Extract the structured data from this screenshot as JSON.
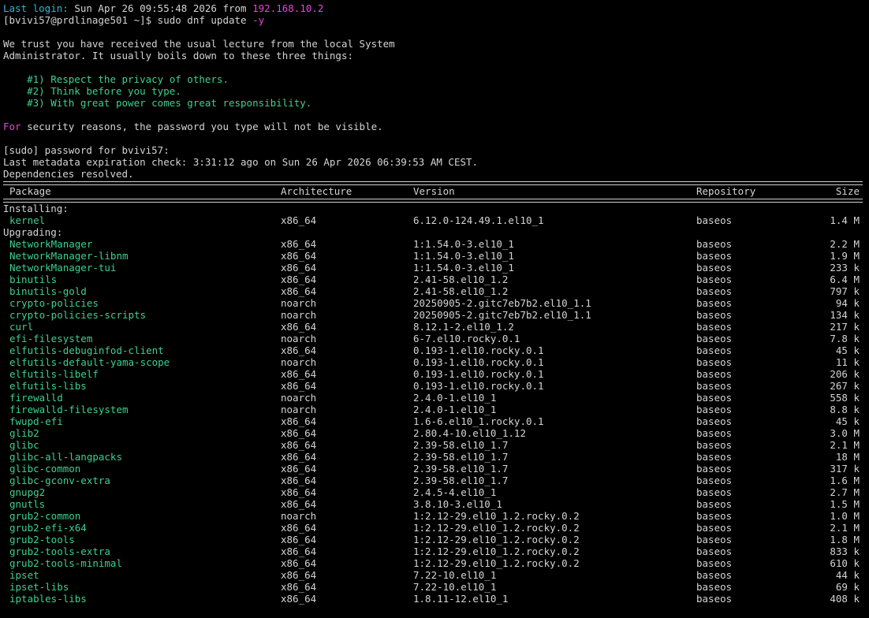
{
  "login": {
    "prefix": "Last login:",
    "date": " Sun Apr 26 09:55:48 2026 ",
    "from": "from ",
    "ip": "192.168.10.2"
  },
  "prompt": {
    "text": "[bvivi57@prdlinage501 ~]$ ",
    "command": "sudo dnf update -y"
  },
  "lecture": {
    "line1": "We trust you have received the usual lecture from the local System",
    "line2": "Administrator. It usually boils down to these three things:",
    "item1": "    #1) Respect the privacy of others.",
    "item2": "    #2) Think before you type.",
    "item3": "    #3) With great power comes great responsibility.",
    "security_for": "For",
    "security_rest": " security reasons, the password you type will not be visible."
  },
  "sudo_prompt": "[sudo] password for bvivi57:",
  "metadata": "Last metadata expiration check: 3:31:12 ago on Sun 26 Apr 2026 06:39:53 AM CEST.",
  "deps": "Dependencies resolved.",
  "table": {
    "headers": {
      "package": "Package",
      "arch": "Architecture",
      "version": "Version",
      "repo": "Repository",
      "size": "Size"
    },
    "installing_label": "Installing:",
    "installing": [
      {
        "name": "kernel",
        "arch": "x86_64",
        "version": "6.12.0-124.49.1.el10_1",
        "repo": "baseos",
        "size": "1.4 M"
      }
    ],
    "upgrading_label": "Upgrading:",
    "upgrading": [
      {
        "name": "NetworkManager",
        "arch": "x86_64",
        "version": "1:1.54.0-3.el10_1",
        "repo": "baseos",
        "size": "2.2 M"
      },
      {
        "name": "NetworkManager-libnm",
        "arch": "x86_64",
        "version": "1:1.54.0-3.el10_1",
        "repo": "baseos",
        "size": "1.9 M"
      },
      {
        "name": "NetworkManager-tui",
        "arch": "x86_64",
        "version": "1:1.54.0-3.el10_1",
        "repo": "baseos",
        "size": "233 k"
      },
      {
        "name": "binutils",
        "arch": "x86_64",
        "version": "2.41-58.el10_1.2",
        "repo": "baseos",
        "size": "6.4 M"
      },
      {
        "name": "binutils-gold",
        "arch": "x86_64",
        "version": "2.41-58.el10_1.2",
        "repo": "baseos",
        "size": "797 k"
      },
      {
        "name": "crypto-policies",
        "arch": "noarch",
        "version": "20250905-2.gitc7eb7b2.el10_1.1",
        "repo": "baseos",
        "size": "94 k"
      },
      {
        "name": "crypto-policies-scripts",
        "arch": "noarch",
        "version": "20250905-2.gitc7eb7b2.el10_1.1",
        "repo": "baseos",
        "size": "134 k"
      },
      {
        "name": "curl",
        "arch": "x86_64",
        "version": "8.12.1-2.el10_1.2",
        "repo": "baseos",
        "size": "217 k"
      },
      {
        "name": "efi-filesystem",
        "arch": "noarch",
        "version": "6-7.el10.rocky.0.1",
        "repo": "baseos",
        "size": "7.8 k"
      },
      {
        "name": "elfutils-debuginfod-client",
        "arch": "x86_64",
        "version": "0.193-1.el10.rocky.0.1",
        "repo": "baseos",
        "size": "45 k"
      },
      {
        "name": "elfutils-default-yama-scope",
        "arch": "noarch",
        "version": "0.193-1.el10.rocky.0.1",
        "repo": "baseos",
        "size": "11 k"
      },
      {
        "name": "elfutils-libelf",
        "arch": "x86_64",
        "version": "0.193-1.el10.rocky.0.1",
        "repo": "baseos",
        "size": "206 k"
      },
      {
        "name": "elfutils-libs",
        "arch": "x86_64",
        "version": "0.193-1.el10.rocky.0.1",
        "repo": "baseos",
        "size": "267 k"
      },
      {
        "name": "firewalld",
        "arch": "noarch",
        "version": "2.4.0-1.el10_1",
        "repo": "baseos",
        "size": "558 k"
      },
      {
        "name": "firewalld-filesystem",
        "arch": "noarch",
        "version": "2.4.0-1.el10_1",
        "repo": "baseos",
        "size": "8.8 k"
      },
      {
        "name": "fwupd-efi",
        "arch": "x86_64",
        "version": "1.6-6.el10_1.rocky.0.1",
        "repo": "baseos",
        "size": "45 k"
      },
      {
        "name": "glib2",
        "arch": "x86_64",
        "version": "2.80.4-10.el10_1.12",
        "repo": "baseos",
        "size": "3.0 M"
      },
      {
        "name": "glibc",
        "arch": "x86_64",
        "version": "2.39-58.el10_1.7",
        "repo": "baseos",
        "size": "2.1 M"
      },
      {
        "name": "glibc-all-langpacks",
        "arch": "x86_64",
        "version": "2.39-58.el10_1.7",
        "repo": "baseos",
        "size": "18 M"
      },
      {
        "name": "glibc-common",
        "arch": "x86_64",
        "version": "2.39-58.el10_1.7",
        "repo": "baseos",
        "size": "317 k"
      },
      {
        "name": "glibc-gconv-extra",
        "arch": "x86_64",
        "version": "2.39-58.el10_1.7",
        "repo": "baseos",
        "size": "1.6 M"
      },
      {
        "name": "gnupg2",
        "arch": "x86_64",
        "version": "2.4.5-4.el10_1",
        "repo": "baseos",
        "size": "2.7 M"
      },
      {
        "name": "gnutls",
        "arch": "x86_64",
        "version": "3.8.10-3.el10_1",
        "repo": "baseos",
        "size": "1.5 M"
      },
      {
        "name": "grub2-common",
        "arch": "noarch",
        "version": "1:2.12-29.el10_1.2.rocky.0.2",
        "repo": "baseos",
        "size": "1.0 M"
      },
      {
        "name": "grub2-efi-x64",
        "arch": "x86_64",
        "version": "1:2.12-29.el10_1.2.rocky.0.2",
        "repo": "baseos",
        "size": "2.1 M"
      },
      {
        "name": "grub2-tools",
        "arch": "x86_64",
        "version": "1:2.12-29.el10_1.2.rocky.0.2",
        "repo": "baseos",
        "size": "1.8 M"
      },
      {
        "name": "grub2-tools-extra",
        "arch": "x86_64",
        "version": "1:2.12-29.el10_1.2.rocky.0.2",
        "repo": "baseos",
        "size": "833 k"
      },
      {
        "name": "grub2-tools-minimal",
        "arch": "x86_64",
        "version": "1:2.12-29.el10_1.2.rocky.0.2",
        "repo": "baseos",
        "size": "610 k"
      },
      {
        "name": "ipset",
        "arch": "x86_64",
        "version": "7.22-10.el10_1",
        "repo": "baseos",
        "size": "44 k"
      },
      {
        "name": "ipset-libs",
        "arch": "x86_64",
        "version": "7.22-10.el10_1",
        "repo": "baseos",
        "size": "69 k"
      },
      {
        "name": "iptables-libs",
        "arch": "x86_64",
        "version": "1.8.11-12.el10_1",
        "repo": "baseos",
        "size": "408 k"
      }
    ]
  },
  "colors": {
    "background": "#000000",
    "text": "#d4d4d4",
    "cyan": "#2eb8d6",
    "magenta": "#e34ad7",
    "green": "#3fcf8e"
  }
}
